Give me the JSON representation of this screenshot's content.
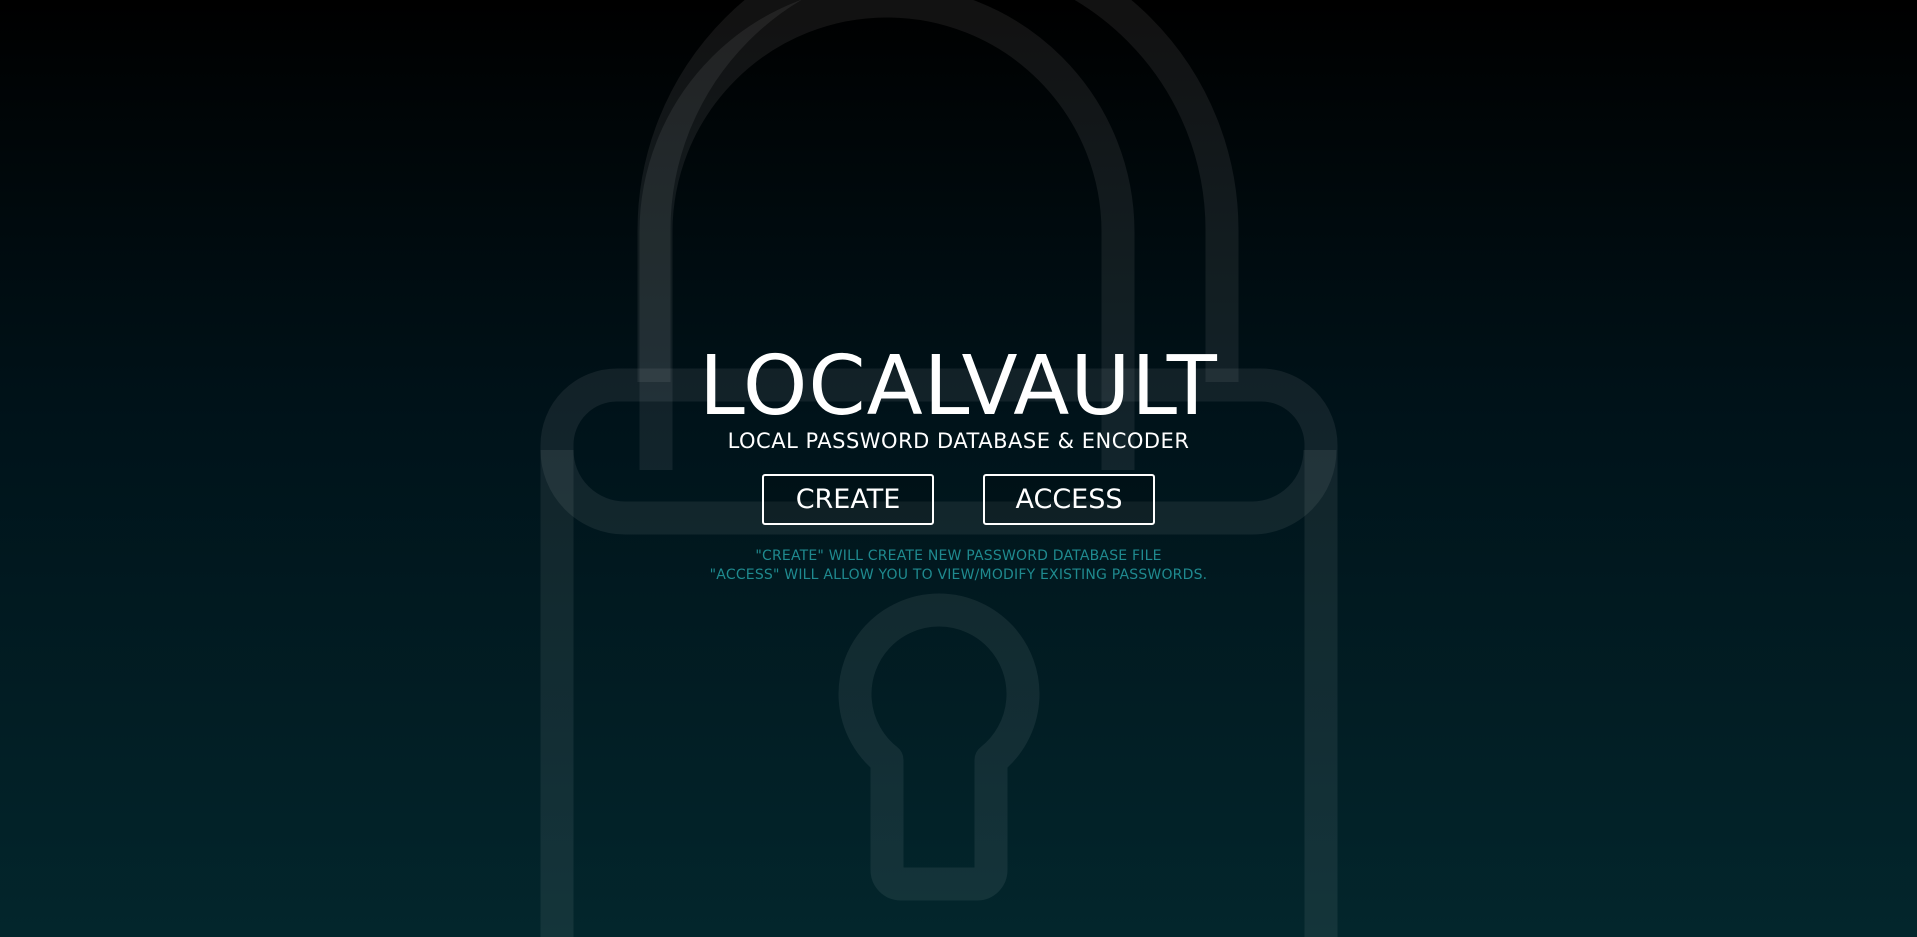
{
  "app": {
    "title": "LOCALVAULT",
    "subtitle": "LOCAL PASSWORD DATABASE & ENCODER"
  },
  "actions": {
    "create_label": "CREATE",
    "access_label": "ACCESS"
  },
  "hints": [
    "\"CREATE\" WILL CREATE NEW PASSWORD DATABASE FILE",
    "\"ACCESS\" WILL ALLOW YOU TO VIEW/MODIFY EXISTING PASSWORDS."
  ],
  "background": {
    "icon": "padlock-icon"
  },
  "colors": {
    "accent": "#1f8a8f",
    "text": "#ffffff",
    "background_top": "#000000",
    "background_bottom": "#03262c",
    "lock_outline": "#14353b"
  }
}
